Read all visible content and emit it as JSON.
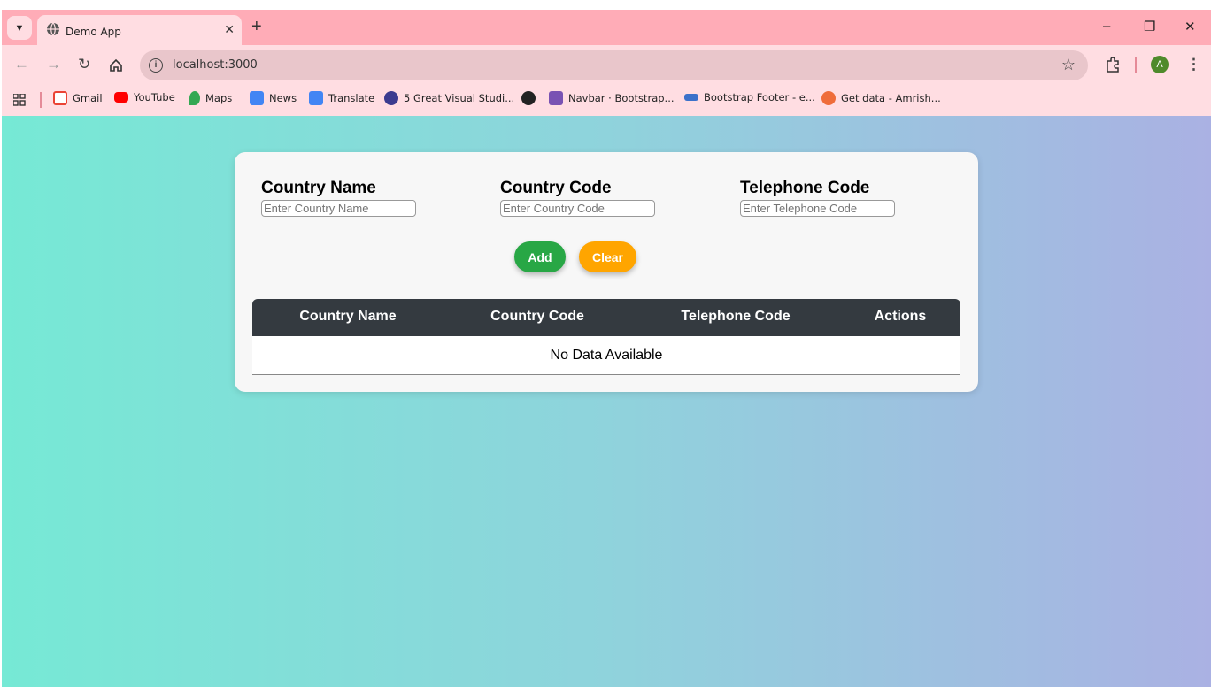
{
  "browser": {
    "tab_title": "Demo App",
    "url": "localhost:3000",
    "avatar_letter": "A",
    "bookmarks": [
      {
        "label": "Gmail",
        "color": "#ea4335"
      },
      {
        "label": "YouTube",
        "color": "#ff0000"
      },
      {
        "label": "Maps",
        "color": "#34a853"
      },
      {
        "label": "News",
        "color": "#4285f4"
      },
      {
        "label": "Translate",
        "color": "#4285f4"
      },
      {
        "label": "5 Great Visual Studi...",
        "color": "#3b3b8f"
      },
      {
        "label": "",
        "color": "#222222"
      },
      {
        "label": "Navbar · Bootstrap...",
        "color": "#7952b3"
      },
      {
        "label": "Bootstrap Footer - e...",
        "color": "#3b71ca"
      },
      {
        "label": "Get data - Amrish...",
        "color": "#ef6c3a"
      }
    ]
  },
  "form": {
    "country_name_label": "Country Name",
    "country_name_placeholder": "Enter Country Name",
    "country_code_label": "Country Code",
    "country_code_placeholder": "Enter Country Code",
    "telephone_code_label": "Telephone Code",
    "telephone_code_placeholder": "Enter Telephone Code",
    "add_label": "Add",
    "clear_label": "Clear"
  },
  "table": {
    "headers": [
      "Country Name",
      "Country Code",
      "Telephone Code",
      "Actions"
    ],
    "empty_message": "No Data Available"
  },
  "colors": {
    "add_button": "#28a745",
    "clear_button": "#ffa500",
    "table_header": "#343a40",
    "tabstrip": "#ffacb7"
  }
}
